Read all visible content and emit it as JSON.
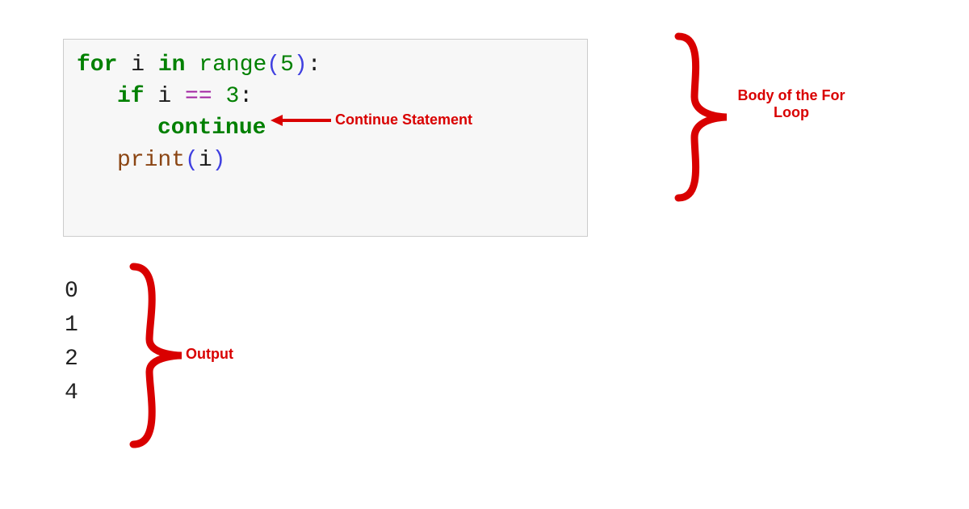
{
  "code": {
    "line1": {
      "for": "for",
      "var": "i",
      "in": "in",
      "range": "range",
      "lparen": "(",
      "arg": "5",
      "rparen": ")",
      "colon": ":"
    },
    "line2": {
      "if": "if",
      "var": "i",
      "eq": "==",
      "val": "3",
      "colon": ":"
    },
    "line3": {
      "continue": "continue"
    },
    "line4": {
      "print": "print",
      "lparen": "(",
      "arg": "i",
      "rparen": ")"
    }
  },
  "annotations": {
    "continue_stmt": "Continue Statement",
    "body_loop": "Body of the For Loop",
    "output": "Output"
  },
  "output": [
    "0",
    "1",
    "2",
    "4"
  ]
}
